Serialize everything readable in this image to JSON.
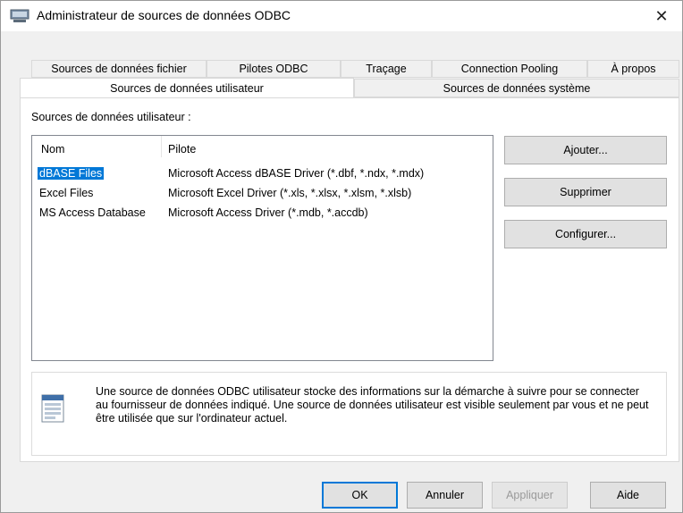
{
  "window": {
    "title": "Administrateur de sources de données ODBC",
    "close_glyph": "✕"
  },
  "tabs_back": [
    "Sources de données fichier",
    "Pilotes ODBC",
    "Traçage",
    "Connection Pooling",
    "À propos"
  ],
  "tabs_front": [
    "Sources de données utilisateur",
    "Sources de données système"
  ],
  "active_tab": "Sources de données utilisateur",
  "panel": {
    "label": "Sources de données utilisateur :",
    "columns": [
      "Nom",
      "Pilote"
    ],
    "rows": [
      {
        "name": "dBASE Files",
        "driver": "Microsoft Access dBASE Driver (*.dbf, *.ndx, *.mdx)",
        "selected": true
      },
      {
        "name": "Excel Files",
        "driver": "Microsoft Excel Driver (*.xls, *.xlsx, *.xlsm, *.xlsb)",
        "selected": false
      },
      {
        "name": "MS Access Database",
        "driver": "Microsoft Access Driver (*.mdb, *.accdb)",
        "selected": false
      }
    ],
    "buttons": {
      "add": "Ajouter...",
      "remove": "Supprimer",
      "configure": "Configurer..."
    },
    "info_text": "Une source de données ODBC utilisateur stocke des informations sur la démarche à suivre pour se connecter au fournisseur de données indiqué.   Une source de données utilisateur est visible seulement par vous et ne peut être utilisée que sur l'ordinateur actuel."
  },
  "footer": {
    "ok": "OK",
    "cancel": "Annuler",
    "apply": "Appliquer",
    "help": "Aide"
  },
  "colors": {
    "selection": "#0078d7",
    "focus_border": "#0078d7"
  }
}
